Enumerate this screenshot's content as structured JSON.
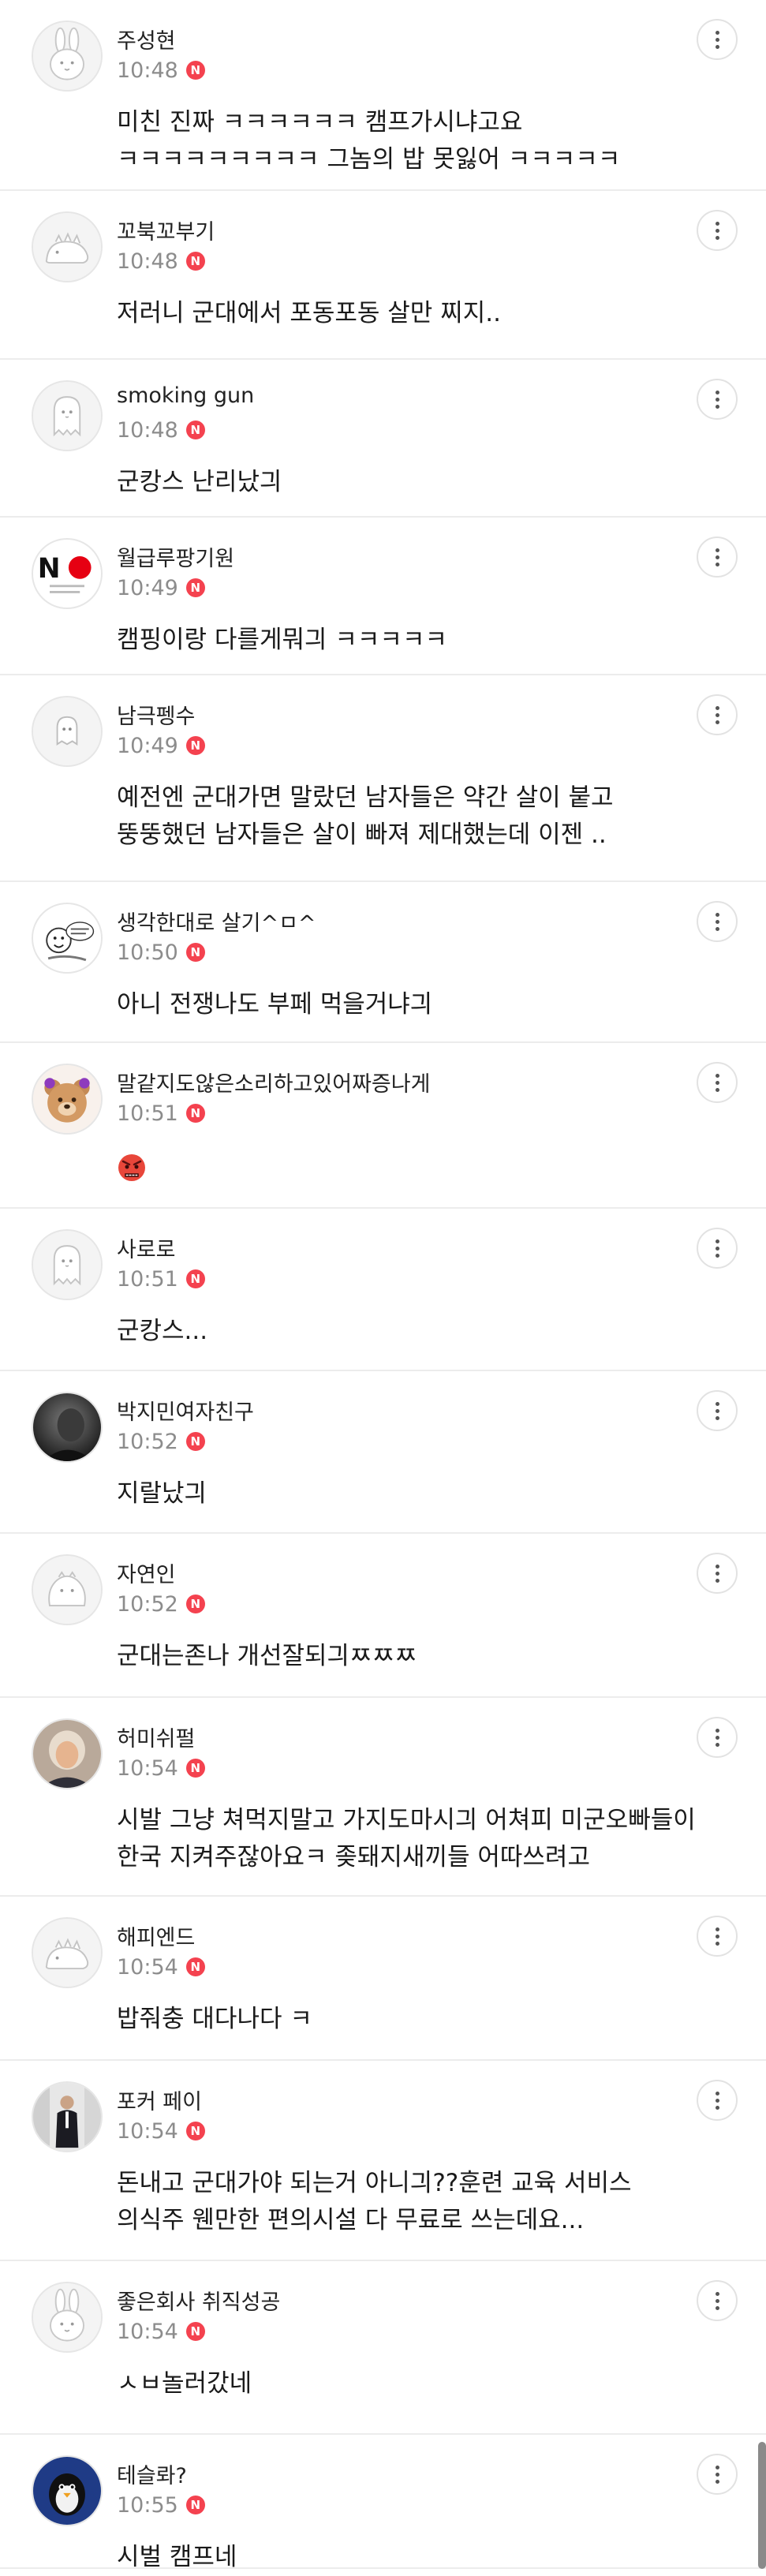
{
  "comments": [
    {
      "nickname": "주성현",
      "time": "10:48",
      "badge": "N",
      "avatar": "rabbit",
      "text": "미친 진짜 ㅋㅋㅋㅋㅋㅋ 캠프가시냐고요\nㅋㅋㅋㅋㅋㅋㅋㅋㅋ 그놈의 밥 못잃어 ㅋㅋㅋㅋㅋ"
    },
    {
      "nickname": "꼬북꼬부기",
      "time": "10:48",
      "badge": "N",
      "avatar": "dino",
      "text": "저러니 군대에서 포동포동 살만 찌지.."
    },
    {
      "nickname": "smoking gun",
      "time": "10:48",
      "badge": "N",
      "avatar": "ghost",
      "text": "군캉스 난리났긔"
    },
    {
      "nickname": "월급루팡기원",
      "time": "10:49",
      "badge": "N",
      "avatar": "no-japan",
      "avatar_text": "NO",
      "text": "캠핑이랑 다를게뭐긔 ㅋㅋㅋㅋㅋ"
    },
    {
      "nickname": "남극펭수",
      "time": "10:49",
      "badge": "N",
      "avatar": "small-ghost",
      "text": "예전엔 군대가면 말랐던 남자들은 약간 살이 붙고\n뚱뚱했던 남자들은 살이 빠져 제대했는데 이젠 .."
    },
    {
      "nickname": "생각한대로 살기^ㅁ^",
      "time": "10:50",
      "badge": "N",
      "avatar": "cartoon",
      "text": "아니 전쟁나도 부페 먹을거냐긔"
    },
    {
      "nickname": "말같지도않은소리하고있어짜증나게",
      "time": "10:51",
      "badge": "N",
      "avatar": "bear",
      "text": "",
      "emoji": "angry-face"
    },
    {
      "nickname": "사로로",
      "time": "10:51",
      "badge": "N",
      "avatar": "ghost",
      "text": "군캉스..."
    },
    {
      "nickname": "박지민여자친구",
      "time": "10:52",
      "badge": "N",
      "avatar": "photo-dark",
      "text": "지랄났긔"
    },
    {
      "nickname": "자연인",
      "time": "10:52",
      "badge": "N",
      "avatar": "blob",
      "text": "군대는존나 개선잘되긔ㅉㅉㅉ"
    },
    {
      "nickname": "허미쉬펄",
      "time": "10:54",
      "badge": "N",
      "avatar": "photo-person",
      "text": "시발 그냥 쳐먹지말고 가지도마시긔 어쳐피 미군오빠들이\n한국 지켜주잖아요ㅋ 좆돼지새끼들 어따쓰려고"
    },
    {
      "nickname": "해피엔드",
      "time": "10:54",
      "badge": "N",
      "avatar": "dino",
      "text": "밥줘충 대다나다 ㅋ"
    },
    {
      "nickname": "포커 페이",
      "time": "10:54",
      "badge": "N",
      "avatar": "photo-suit",
      "text": "돈내고 군대가야 되는거 아니긔??훈련 교육 서비스\n의식주 웬만한 편의시설 다 무료로 쓰는데요..."
    },
    {
      "nickname": "좋은회사 취직성공",
      "time": "10:54",
      "badge": "N",
      "avatar": "rabbit",
      "text": "ㅅㅂ놀러갔네"
    },
    {
      "nickname": "테슬롸?",
      "time": "10:55",
      "badge": "N",
      "avatar": "penguin",
      "text": "시벌 캠프네"
    }
  ],
  "icons": {
    "more": "more-vertical-icon",
    "new_badge_color": "#f4424f"
  }
}
